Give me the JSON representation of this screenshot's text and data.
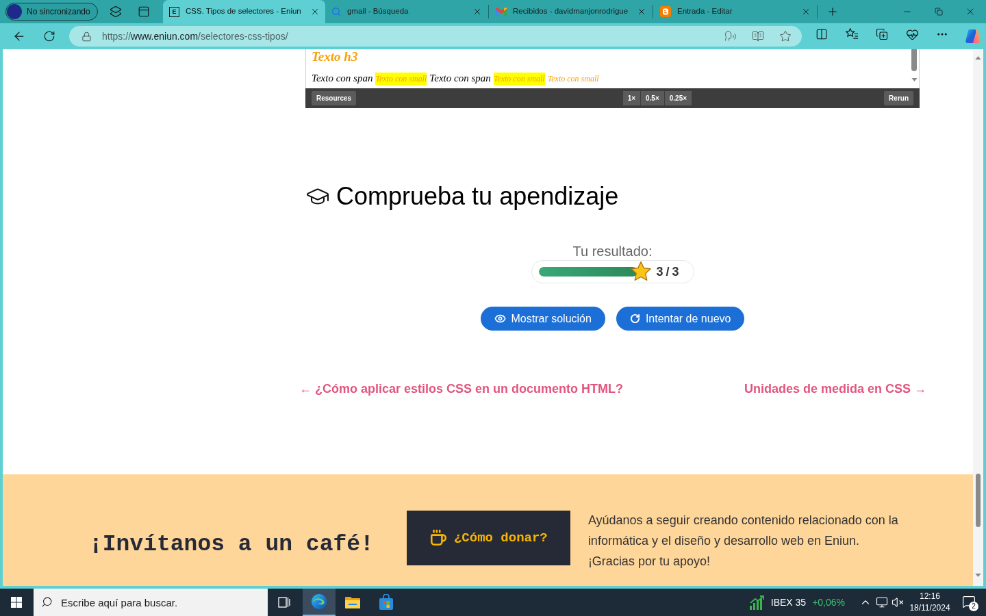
{
  "browser": {
    "profile": {
      "label": "No sincronizando"
    },
    "tabs": [
      {
        "kind": "letter",
        "favicon": "E",
        "title": "CSS. Tipos de selectores - Eniun",
        "selected": true
      },
      {
        "kind": "search",
        "title": "gmail - Búsqueda",
        "selected": false
      },
      {
        "kind": "mail",
        "title": "Recibidos - davidmanjonrodrigue",
        "selected": false
      },
      {
        "kind": "blog",
        "title": "Entrada - Editar",
        "selected": false
      }
    ],
    "address": {
      "scheme": "https://",
      "host": "www.eniun.com",
      "path": "/selectores-css-tipos/"
    }
  },
  "page": {
    "preview": {
      "heading": "Texto h3",
      "fragments": [
        {
          "kind": "span",
          "text": "Texto con span"
        },
        {
          "kind": "marked",
          "text": "Texto con small"
        },
        {
          "kind": "span",
          "text": "Texto con span"
        },
        {
          "kind": "marked",
          "text": "Texto con small"
        },
        {
          "kind": "small",
          "text": "Texto con small"
        }
      ],
      "resources": "Resources",
      "zoom_buttons": [
        "1×",
        "0.5×",
        "0.25×"
      ],
      "rerun": "Rerun"
    },
    "quiz": {
      "title": "Comprueba tu apendizaje",
      "result_label": "Tu resultado:",
      "level": 1,
      "score": "3 / 3",
      "buttons": [
        {
          "kind": "solution",
          "label": "Mostrar solución"
        },
        {
          "kind": "retry",
          "label": "Intentar de nuevo"
        }
      ]
    },
    "post_nav": {
      "previous": "← ¿Cómo aplicar estilos CSS en un documento HTML?",
      "next": "Unidades de medida en CSS →"
    },
    "footer": {
      "title": "¡Invítanos a un café!",
      "donate_button": "¿Cómo donar?",
      "paragraphs": [
        "Ayúdanos a seguir creando contenido relacionado con la informática y el diseño y desarrollo web en Eniun.",
        "¡Gracias por tu apoyo!"
      ]
    }
  },
  "taskbar": {
    "search": {
      "placeholder": "Escribe aquí para buscar."
    },
    "pinned": [
      {
        "kind": "browser",
        "selected": true
      },
      {
        "kind": "folder",
        "selected": false
      },
      {
        "kind": "store",
        "selected": false
      }
    ],
    "stock": {
      "name": "IBEX 35",
      "change": "+0,06%"
    },
    "clock": {
      "time": "12:16",
      "date": "18/11/2024"
    },
    "notifications": {
      "count": "2"
    }
  }
}
